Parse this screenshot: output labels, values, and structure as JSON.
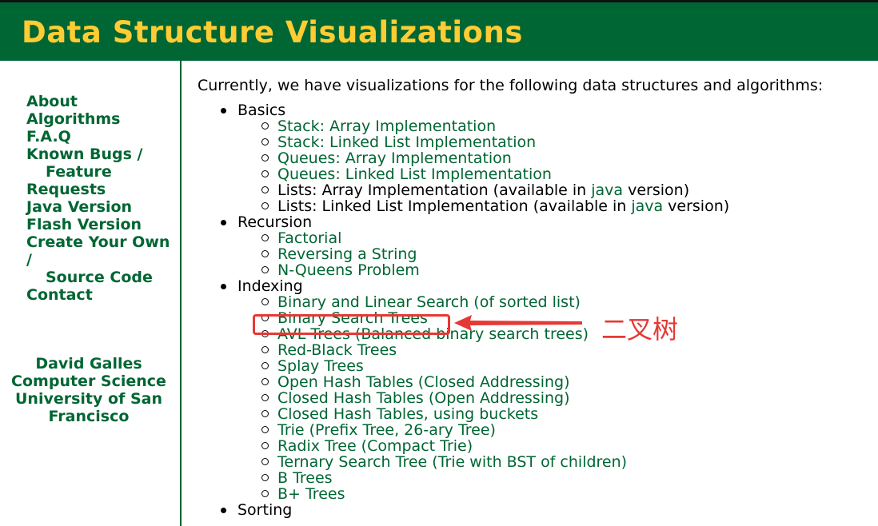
{
  "header": {
    "title": "Data Structure Visualizations"
  },
  "sidebar": {
    "nav": [
      {
        "label": "About"
      },
      {
        "label": "Algorithms"
      },
      {
        "label": "F.A.Q"
      },
      {
        "label": "Known Bugs /",
        "label2": "Feature",
        "label3": "Requests"
      },
      {
        "label": "Java Version"
      },
      {
        "label": "Flash Version"
      },
      {
        "label": "Create Your Own",
        "label2": "/",
        "label3": "Source Code"
      },
      {
        "label": "Contact"
      }
    ],
    "author": {
      "name": "David Galles",
      "dept": "Computer Science",
      "univ1": "University of San",
      "univ2": "Francisco"
    }
  },
  "main": {
    "intro": "Currently, we have visualizations for the following data structures and algorithms:",
    "sections": [
      {
        "title": "Basics",
        "items": [
          {
            "label": "Stack: Array Implementation"
          },
          {
            "label": "Stack: Linked List Implementation"
          },
          {
            "label": "Queues: Array Implementation"
          },
          {
            "label": "Queues: Linked List Implementation"
          },
          {
            "pre": "Lists: Array Implementation (available in ",
            "link": "java",
            "post": " version)"
          },
          {
            "pre": "Lists: Linked List Implementation (available in ",
            "link": "java",
            "post": " version)"
          }
        ]
      },
      {
        "title": "Recursion",
        "items": [
          {
            "label": "Factorial"
          },
          {
            "label": "Reversing a String"
          },
          {
            "label": "N-Queens Problem"
          }
        ]
      },
      {
        "title": "Indexing",
        "items": [
          {
            "label": "Binary and Linear Search (of sorted list)"
          },
          {
            "label": "Binary Search Trees"
          },
          {
            "label": "AVL Trees (Balanced binary search trees)"
          },
          {
            "label": "Red-Black Trees"
          },
          {
            "label": "Splay Trees"
          },
          {
            "label": "Open Hash Tables (Closed Addressing)"
          },
          {
            "label": "Closed Hash Tables (Open Addressing)"
          },
          {
            "label": "Closed Hash Tables, using buckets"
          },
          {
            "label": "Trie (Prefix Tree, 26-ary Tree)"
          },
          {
            "label": "Radix Tree (Compact Trie)"
          },
          {
            "label": "Ternary Search Tree (Trie with BST of children)"
          },
          {
            "label": "B Trees"
          },
          {
            "label": "B+ Trees"
          }
        ]
      },
      {
        "title": "Sorting"
      }
    ]
  },
  "annotation": {
    "text": "二叉树",
    "color": "#E53935"
  },
  "colors": {
    "header_bg": "#006633",
    "title": "#FFCC33",
    "link": "#006633"
  }
}
